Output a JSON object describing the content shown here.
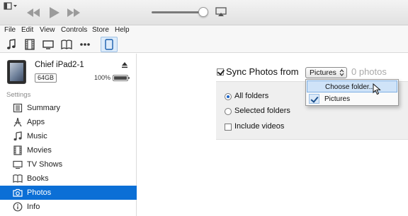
{
  "menubar": {
    "items": [
      "File",
      "Edit",
      "View",
      "Controls",
      "Store",
      "Help"
    ]
  },
  "device": {
    "name": "Chief iPad2-1",
    "capacity": "64GB",
    "battery_percent": "100%",
    "battery_level": 1.0
  },
  "sidebar": {
    "section_header": "Settings",
    "items": [
      {
        "label": "Summary",
        "icon": "summary-icon"
      },
      {
        "label": "Apps",
        "icon": "apps-icon"
      },
      {
        "label": "Music",
        "icon": "music-note-icon"
      },
      {
        "label": "Movies",
        "icon": "film-icon"
      },
      {
        "label": "TV Shows",
        "icon": "tv-icon"
      },
      {
        "label": "Books",
        "icon": "book-icon"
      },
      {
        "label": "Photos",
        "icon": "camera-icon",
        "active": true
      },
      {
        "label": "Info",
        "icon": "info-icon"
      }
    ]
  },
  "sync": {
    "checkbox_checked": true,
    "label": "Sync Photos from",
    "source_selected": "Pictures",
    "photo_count": "0 photos",
    "dropdown_options": [
      {
        "label": "Choose folder...",
        "highlighted": true
      },
      {
        "label": "Pictures",
        "checked": true
      }
    ],
    "options": {
      "all_folders": "All folders",
      "selected_folders": "Selected folders",
      "include_videos": "Include videos",
      "mode": "all_folders",
      "include_videos_checked": false
    }
  },
  "colors": {
    "accent": "#0b6fd6",
    "panel_bg": "#efefef",
    "muted_text": "#a9a9a9"
  }
}
